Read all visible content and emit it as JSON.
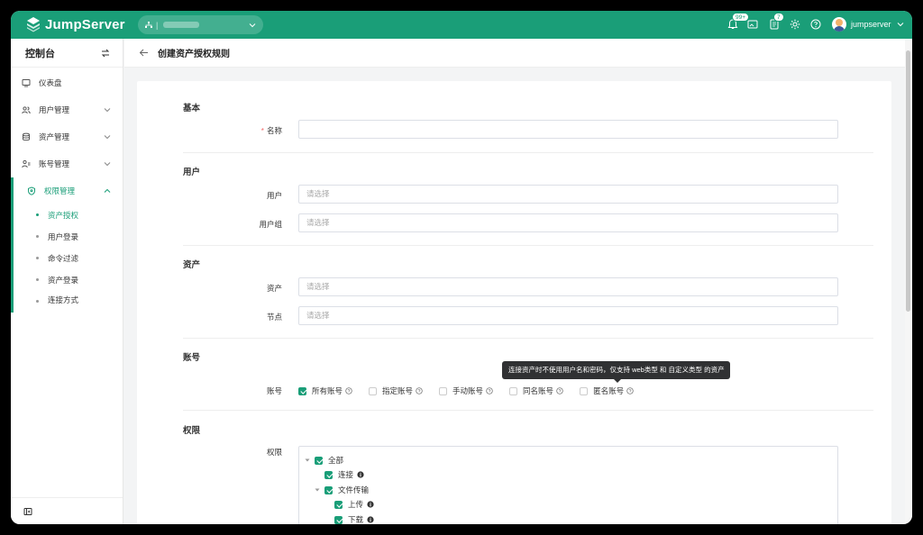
{
  "app": {
    "brand": "JumpServer",
    "org_selector_icon": "org-icon",
    "notifications_badge": "99+",
    "tickets_badge": "7",
    "username": "jumpserver",
    "accent": "#1a9e78"
  },
  "sidebar": {
    "title": "控制台",
    "items": [
      {
        "label": "仪表盘",
        "icon": "dashboard-icon"
      },
      {
        "label": "用户管理",
        "icon": "users-icon"
      },
      {
        "label": "资产管理",
        "icon": "assets-icon"
      },
      {
        "label": "账号管理",
        "icon": "accounts-icon"
      },
      {
        "label": "权限管理",
        "icon": "shield-icon"
      }
    ],
    "subitems": [
      {
        "label": "资产授权"
      },
      {
        "label": "用户登录"
      },
      {
        "label": "命令过滤"
      },
      {
        "label": "资产登录"
      },
      {
        "label": "连接方式"
      }
    ]
  },
  "page": {
    "title": "创建资产授权规则"
  },
  "form": {
    "sections": {
      "basic": "基本",
      "user": "用户",
      "asset": "资产",
      "account": "账号",
      "permission": "权限"
    },
    "fields": {
      "name_label": "名称",
      "name_value": "",
      "user_label": "用户",
      "user_placeholder": "请选择",
      "usergroup_label": "用户组",
      "usergroup_placeholder": "请选择",
      "asset_label": "资产",
      "asset_placeholder": "请选择",
      "node_label": "节点",
      "node_placeholder": "请选择",
      "account_label": "账号",
      "permission_label": "权限"
    },
    "account_options": [
      {
        "label": "所有账号",
        "checked": true
      },
      {
        "label": "指定账号",
        "checked": false
      },
      {
        "label": "手动账号",
        "checked": false
      },
      {
        "label": "同名账号",
        "checked": false
      },
      {
        "label": "匿名账号",
        "checked": false
      }
    ],
    "tooltip": "连接资产时不使用用户名和密码，仅支持 web类型 和 自定义类型 的资产",
    "permission_tree": [
      {
        "label": "全部",
        "checked": true
      },
      {
        "label": "连接",
        "checked": true
      },
      {
        "label": "文件传输",
        "checked": true
      },
      {
        "label": "上传",
        "checked": true
      },
      {
        "label": "下载",
        "checked": true
      }
    ]
  }
}
